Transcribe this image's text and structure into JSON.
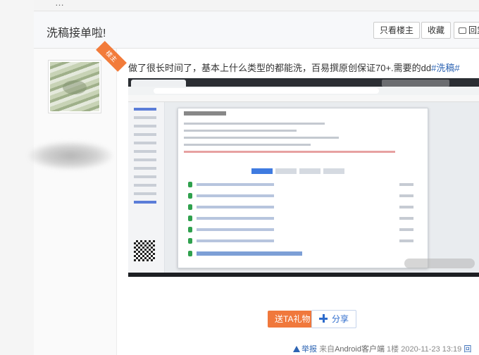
{
  "top": {
    "cut_text": "…"
  },
  "header": {
    "title": "洗稿接单啦!",
    "only_op_label": "只看楼主",
    "favorite_label": "收藏",
    "reply_label": "回复"
  },
  "post": {
    "badge": "楼主",
    "body_text": "做了很长时间了，基本上什么类型的都能洗，百易撰原创保证70+.需要的dd",
    "hashtag": "#洗稿#",
    "gift_button": "送TA礼物",
    "share_button": "分享"
  },
  "footer": {
    "report": "举报",
    "source_prefix": "来自",
    "client": "Android客户端",
    "floor": "1楼",
    "datetime": "2020-11-23 13:19",
    "reply": "回"
  },
  "icons": [
    "reply-icon",
    "plus-icon",
    "warning-icon"
  ],
  "colors": {
    "accent": "#2d64b3",
    "gift": "#f0783c",
    "badge": "#f27b3a"
  }
}
